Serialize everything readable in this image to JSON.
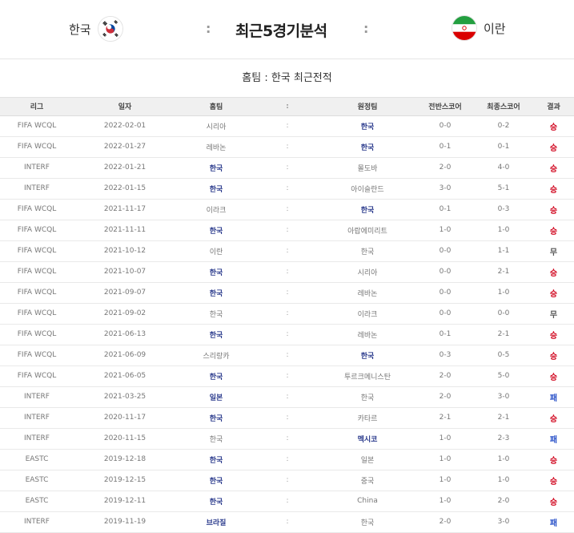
{
  "header": {
    "home_team": "한국",
    "away_team": "이란",
    "title": "최근5경기분석",
    "separator": ":"
  },
  "subheader": {
    "label": "홈팀 : 한국 최근전적"
  },
  "columns": [
    "리그",
    "일자",
    "홈팀",
    ":",
    "원정팀",
    "전반스코어",
    "최종스코어",
    "결과"
  ],
  "colors": {
    "win": "#d0021b",
    "lose": "#2a52c9",
    "team_highlight": "#2a3a8c"
  },
  "rows": [
    {
      "league": "FIFA WCQL",
      "date": "2022-02-01",
      "home": "시리아",
      "sep": ":",
      "away": "한국",
      "half": "0-0",
      "final": "0-2",
      "result": "승",
      "hl": "away",
      "rc": "win"
    },
    {
      "league": "FIFA WCQL",
      "date": "2022-01-27",
      "home": "레바논",
      "sep": ":",
      "away": "한국",
      "half": "0-1",
      "final": "0-1",
      "result": "승",
      "hl": "away",
      "rc": "win"
    },
    {
      "league": "INTERF",
      "date": "2022-01-21",
      "home": "한국",
      "sep": ":",
      "away": "몰도바",
      "half": "2-0",
      "final": "4-0",
      "result": "승",
      "hl": "home",
      "rc": "win"
    },
    {
      "league": "INTERF",
      "date": "2022-01-15",
      "home": "한국",
      "sep": ":",
      "away": "아이슬란드",
      "half": "3-0",
      "final": "5-1",
      "result": "승",
      "hl": "home",
      "rc": "win"
    },
    {
      "league": "FIFA WCQL",
      "date": "2021-11-17",
      "home": "이라크",
      "sep": ":",
      "away": "한국",
      "half": "0-1",
      "final": "0-3",
      "result": "승",
      "hl": "away",
      "rc": "win"
    },
    {
      "league": "FIFA WCQL",
      "date": "2021-11-11",
      "home": "한국",
      "sep": ":",
      "away": "아랍에미리트",
      "half": "1-0",
      "final": "1-0",
      "result": "승",
      "hl": "home",
      "rc": "win"
    },
    {
      "league": "FIFA WCQL",
      "date": "2021-10-12",
      "home": "이란",
      "sep": ":",
      "away": "한국",
      "half": "0-0",
      "final": "1-1",
      "result": "무",
      "hl": "none",
      "rc": "draw"
    },
    {
      "league": "FIFA WCQL",
      "date": "2021-10-07",
      "home": "한국",
      "sep": ":",
      "away": "시리아",
      "half": "0-0",
      "final": "2-1",
      "result": "승",
      "hl": "home",
      "rc": "win"
    },
    {
      "league": "FIFA WCQL",
      "date": "2021-09-07",
      "home": "한국",
      "sep": ":",
      "away": "레바논",
      "half": "0-0",
      "final": "1-0",
      "result": "승",
      "hl": "home",
      "rc": "win"
    },
    {
      "league": "FIFA WCQL",
      "date": "2021-09-02",
      "home": "한국",
      "sep": ":",
      "away": "이라크",
      "half": "0-0",
      "final": "0-0",
      "result": "무",
      "hl": "none",
      "rc": "draw"
    },
    {
      "league": "FIFA WCQL",
      "date": "2021-06-13",
      "home": "한국",
      "sep": ":",
      "away": "레바논",
      "half": "0-1",
      "final": "2-1",
      "result": "승",
      "hl": "home",
      "rc": "win"
    },
    {
      "league": "FIFA WCQL",
      "date": "2021-06-09",
      "home": "스리랑카",
      "sep": ":",
      "away": "한국",
      "half": "0-3",
      "final": "0-5",
      "result": "승",
      "hl": "away",
      "rc": "win"
    },
    {
      "league": "FIFA WCQL",
      "date": "2021-06-05",
      "home": "한국",
      "sep": ":",
      "away": "투르크메니스탄",
      "half": "2-0",
      "final": "5-0",
      "result": "승",
      "hl": "home",
      "rc": "win"
    },
    {
      "league": "INTERF",
      "date": "2021-03-25",
      "home": "일본",
      "sep": ":",
      "away": "한국",
      "half": "2-0",
      "final": "3-0",
      "result": "패",
      "hl": "home",
      "rc": "lose"
    },
    {
      "league": "INTERF",
      "date": "2020-11-17",
      "home": "한국",
      "sep": ":",
      "away": "카타르",
      "half": "2-1",
      "final": "2-1",
      "result": "승",
      "hl": "home",
      "rc": "win"
    },
    {
      "league": "INTERF",
      "date": "2020-11-15",
      "home": "한국",
      "sep": ":",
      "away": "멕시코",
      "half": "1-0",
      "final": "2-3",
      "result": "패",
      "hl": "away",
      "rc": "lose"
    },
    {
      "league": "EASTC",
      "date": "2019-12-18",
      "home": "한국",
      "sep": ":",
      "away": "일본",
      "half": "1-0",
      "final": "1-0",
      "result": "승",
      "hl": "home",
      "rc": "win"
    },
    {
      "league": "EASTC",
      "date": "2019-12-15",
      "home": "한국",
      "sep": ":",
      "away": "중국",
      "half": "1-0",
      "final": "1-0",
      "result": "승",
      "hl": "home",
      "rc": "win"
    },
    {
      "league": "EASTC",
      "date": "2019-12-11",
      "home": "한국",
      "sep": ":",
      "away": "China",
      "half": "1-0",
      "final": "2-0",
      "result": "승",
      "hl": "home",
      "rc": "win"
    },
    {
      "league": "INTERF",
      "date": "2019-11-19",
      "home": "브라질",
      "sep": ":",
      "away": "한국",
      "half": "2-0",
      "final": "3-0",
      "result": "패",
      "hl": "home",
      "rc": "lose"
    }
  ]
}
